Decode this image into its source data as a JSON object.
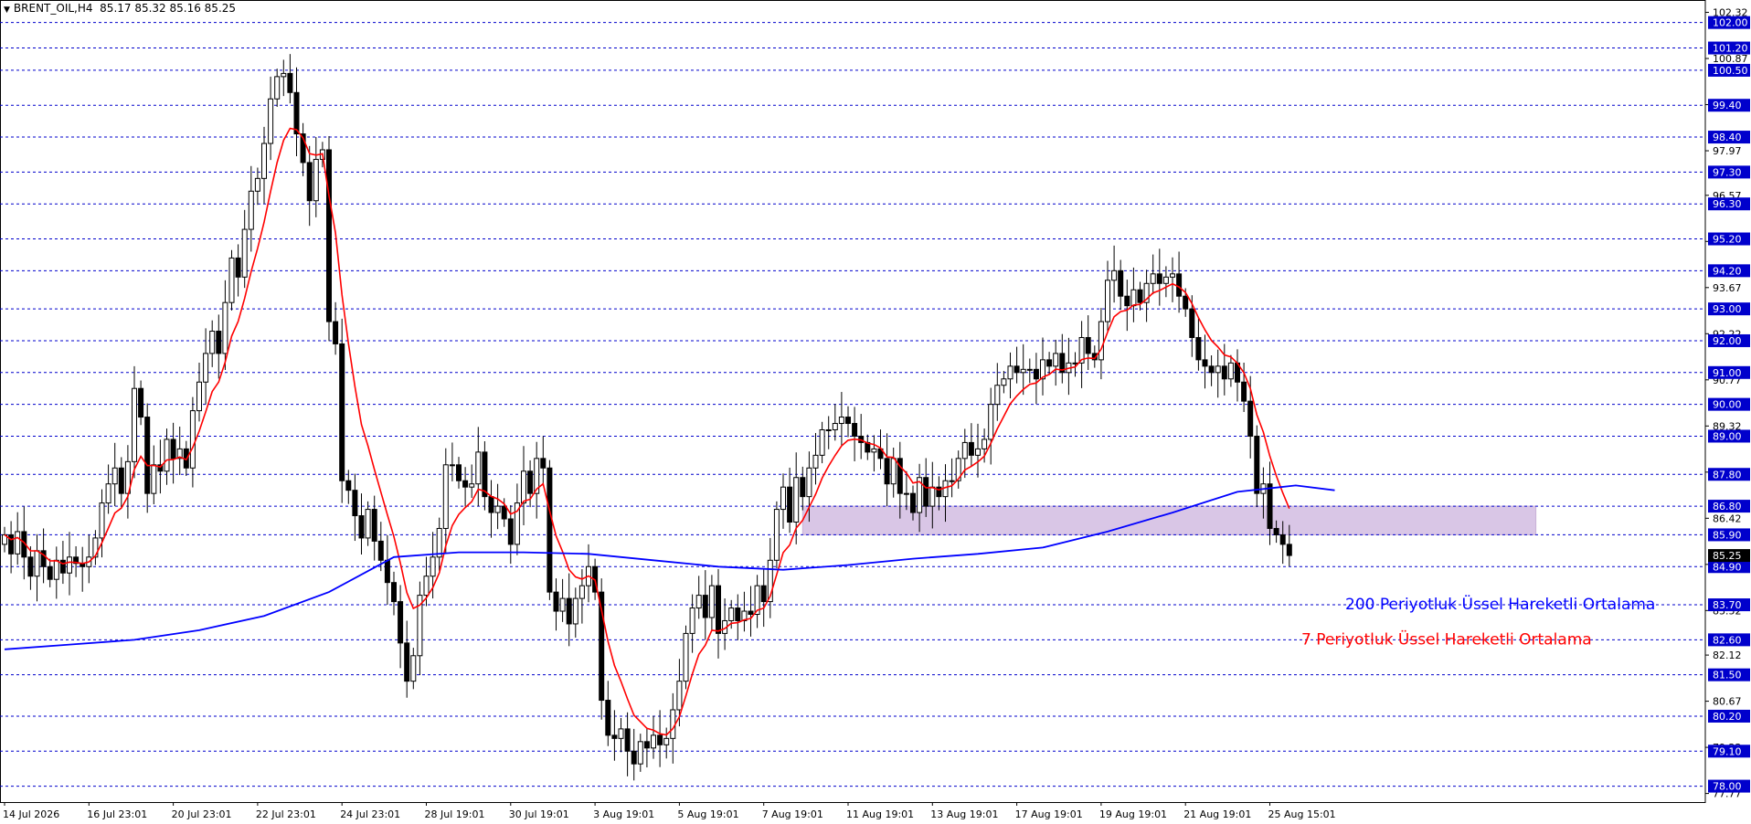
{
  "header": {
    "symbol": "BRENT_OIL,H4",
    "ohlc": "85.17 85.32 85.16 85.25"
  },
  "chart_data": {
    "type": "candlestick",
    "ylim": [
      77.5,
      102.45
    ],
    "y_ticks": [
      102.32,
      100.87,
      99.42,
      97.97,
      96.57,
      95.12,
      93.67,
      92.22,
      90.77,
      89.32,
      87.87,
      86.42,
      84.97,
      83.52,
      82.12,
      80.67,
      79.22,
      77.77
    ],
    "hlines": [
      102.0,
      101.2,
      100.5,
      99.4,
      98.4,
      97.3,
      96.3,
      95.2,
      94.2,
      93.0,
      92.0,
      91.0,
      90.0,
      89.0,
      87.8,
      86.8,
      85.9,
      84.9,
      83.7,
      82.6,
      81.5,
      80.2,
      79.1,
      78.0
    ],
    "hline_labels": [
      "102.00",
      "101.20",
      "100.50",
      "99.40",
      "98.40",
      "97.30",
      "96.30",
      "95.20",
      "94.20",
      "93.00",
      "92.00",
      "91.00",
      "90.00",
      "89.00",
      "87.80",
      "86.80",
      "85.90",
      "84.90",
      "83.70",
      "82.60",
      "81.50",
      "80.20",
      "79.10",
      "78.00"
    ],
    "current_price": 85.25,
    "current_price_label": "85.25",
    "x_labels": [
      "14 Jul 2026",
      "16 Jul 23:01",
      "20 Jul 23:01",
      "22 Jul 23:01",
      "24 Jul 23:01",
      "28 Jul 19:01",
      "30 Jul 19:01",
      "3 Aug 19:01",
      "5 Aug 19:01",
      "7 Aug 19:01",
      "11 Aug 19:01",
      "13 Aug 19:01",
      "17 Aug 19:01",
      "19 Aug 19:01",
      "21 Aug 19:01",
      "25 Aug 15:01"
    ],
    "x_label_bars": [
      0,
      13,
      26,
      39,
      52,
      65,
      78,
      91,
      104,
      117,
      130,
      143,
      156,
      169,
      182,
      195
    ],
    "zone": {
      "from": 85.9,
      "to": 86.8,
      "start_bar": 123,
      "end_bar": 236
    },
    "close": [
      85.9,
      85.3,
      86.0,
      85.2,
      84.6,
      85.4,
      84.9,
      84.5,
      85.1,
      84.7,
      85.2,
      85.0,
      84.9,
      85.2,
      85.8,
      86.9,
      87.5,
      88.0,
      87.2,
      88.2,
      90.5,
      89.6,
      87.2,
      88.1,
      87.9,
      88.9,
      88.3,
      88.6,
      88.0,
      89.8,
      90.7,
      91.6,
      92.3,
      91.6,
      93.2,
      94.6,
      94.0,
      95.5,
      96.7,
      97.1,
      98.2,
      99.6,
      100.3,
      100.4,
      99.8,
      98.5,
      97.6,
      96.4,
      97.7,
      98.0,
      92.6,
      91.9,
      87.6,
      87.3,
      86.5,
      85.8,
      86.7,
      85.7,
      85.1,
      84.4,
      83.8,
      82.5,
      81.3,
      82.1,
      84.0,
      84.6,
      85.2,
      86.1,
      88.1,
      88.1,
      87.6,
      87.4,
      87.5,
      88.5,
      87.1,
      86.6,
      86.8,
      86.4,
      85.6,
      86.9,
      87.9,
      87.2,
      88.3,
      88.0,
      84.1,
      83.5,
      83.9,
      83.1,
      83.9,
      84.3,
      84.9,
      84.1,
      80.7,
      79.6,
      79.5,
      79.8,
      79.1,
      78.7,
      79.4,
      79.2,
      79.6,
      79.3,
      79.5,
      80.4,
      81.3,
      82.8,
      83.6,
      84.0,
      83.3,
      84.3,
      82.8,
      83.2,
      83.6,
      83.2,
      83.5,
      83.4,
      84.3,
      83.8,
      85.1,
      86.7,
      87.4,
      86.3,
      87.7,
      87.1,
      88.0,
      88.4,
      89.2,
      89.2,
      89.4,
      89.6,
      89.4,
      89.0,
      88.8,
      88.5,
      88.6,
      88.3,
      87.5,
      88.3,
      87.2,
      87.2,
      86.6,
      87.7,
      86.8,
      87.4,
      87.1,
      87.6,
      87.6,
      88.3,
      88.8,
      88.4,
      88.6,
      88.9,
      90.0,
      90.6,
      90.8,
      91.2,
      91.0,
      91.1,
      91.1,
      90.8,
      91.4,
      91.2,
      91.6,
      91.0,
      91.3,
      91.3,
      92.1,
      91.6,
      91.4,
      92.6,
      93.9,
      94.2,
      93.4,
      93.1,
      93.6,
      93.2,
      93.8,
      94.1,
      93.8,
      94.0,
      94.1,
      93.4,
      93.0,
      92.1,
      91.4,
      91.2,
      91.0,
      91.2,
      90.8,
      91.3,
      90.7,
      90.1,
      89.0,
      87.2,
      87.5,
      86.1,
      85.9,
      85.6,
      85.25
    ],
    "open": [
      85.6,
      85.9,
      85.3,
      86.0,
      85.2,
      84.6,
      85.4,
      84.9,
      84.5,
      85.1,
      84.7,
      85.2,
      85.0,
      84.9,
      85.2,
      85.8,
      86.9,
      87.5,
      88.0,
      87.2,
      88.2,
      90.5,
      89.6,
      87.2,
      88.1,
      87.9,
      88.9,
      88.3,
      88.6,
      88.0,
      89.8,
      90.7,
      91.6,
      92.3,
      91.6,
      93.2,
      94.6,
      94.0,
      95.5,
      96.7,
      97.1,
      98.2,
      99.6,
      100.3,
      100.4,
      99.8,
      98.5,
      97.6,
      96.4,
      97.7,
      98.0,
      92.6,
      91.9,
      87.6,
      87.3,
      86.5,
      85.8,
      86.7,
      85.7,
      85.1,
      84.4,
      83.8,
      82.5,
      81.3,
      82.1,
      84.0,
      84.6,
      85.2,
      86.1,
      88.1,
      88.1,
      87.6,
      87.4,
      87.5,
      88.5,
      87.1,
      86.6,
      86.8,
      86.4,
      85.6,
      86.9,
      87.9,
      87.2,
      88.3,
      88.0,
      84.1,
      83.5,
      83.9,
      83.1,
      83.9,
      84.3,
      84.9,
      84.1,
      80.7,
      79.6,
      79.5,
      79.8,
      79.1,
      78.7,
      79.4,
      79.2,
      79.6,
      79.3,
      79.5,
      80.4,
      81.3,
      82.8,
      83.6,
      84.0,
      83.3,
      84.3,
      82.8,
      83.2,
      83.6,
      83.2,
      83.5,
      83.4,
      84.3,
      83.8,
      85.1,
      86.7,
      87.4,
      86.3,
      87.7,
      87.1,
      88.0,
      88.4,
      89.2,
      89.2,
      89.4,
      89.6,
      89.4,
      89.0,
      88.8,
      88.5,
      88.6,
      88.3,
      87.5,
      88.3,
      87.2,
      87.2,
      86.6,
      87.7,
      86.8,
      87.4,
      87.1,
      87.6,
      87.6,
      88.3,
      88.8,
      88.4,
      88.6,
      88.9,
      90.0,
      90.6,
      90.8,
      91.2,
      91.0,
      91.1,
      91.1,
      90.8,
      91.4,
      91.2,
      91.6,
      91.0,
      91.3,
      91.3,
      92.1,
      91.6,
      91.4,
      92.6,
      93.9,
      94.2,
      93.4,
      93.1,
      93.6,
      93.2,
      93.8,
      94.1,
      93.8,
      94.0,
      94.1,
      93.4,
      93.0,
      92.1,
      91.4,
      91.2,
      91.0,
      91.2,
      90.8,
      91.3,
      90.7,
      90.1,
      89.0,
      87.2,
      87.5,
      86.1,
      85.9,
      85.6
    ],
    "ema200_points": [
      [
        0,
        82.3
      ],
      [
        10,
        82.45
      ],
      [
        20,
        82.6
      ],
      [
        30,
        82.9
      ],
      [
        40,
        83.35
      ],
      [
        50,
        84.1
      ],
      [
        60,
        85.2
      ],
      [
        70,
        85.35
      ],
      [
        80,
        85.35
      ],
      [
        90,
        85.3
      ],
      [
        100,
        85.1
      ],
      [
        110,
        84.9
      ],
      [
        120,
        84.8
      ],
      [
        130,
        84.95
      ],
      [
        140,
        85.15
      ],
      [
        150,
        85.3
      ],
      [
        160,
        85.5
      ],
      [
        170,
        86.0
      ],
      [
        180,
        86.6
      ],
      [
        190,
        87.25
      ],
      [
        199,
        87.45
      ],
      [
        205,
        87.3
      ]
    ],
    "ema200_label": "200 Periyotluk Üssel Hareketli Ortalama",
    "ema200_color": "#0000ff",
    "ema7_label": "7 Periyotluk Üssel Hareketli Ortalama",
    "ema7_color": "#ff0000",
    "grid_color": "#0000cc",
    "zone_color": "#d9c6e6"
  }
}
